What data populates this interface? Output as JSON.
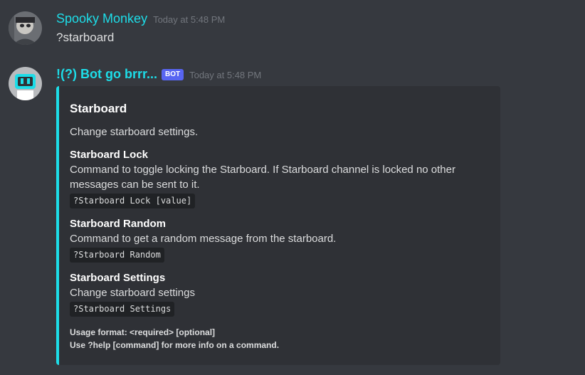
{
  "messages": [
    {
      "username": "Spooky Monkey",
      "timestamp": "Today at 5:48 PM",
      "content": "?starboard",
      "name_color": "#1ddde8"
    },
    {
      "username": "!(?) Bot go brrr...",
      "badge": "BOT",
      "timestamp": "Today at 5:48 PM",
      "name_color": "#1ddde8",
      "embed": {
        "accent_color": "#1ddde8",
        "title": "Starboard",
        "description": "Change starboard settings.",
        "fields": [
          {
            "name": "Starboard Lock",
            "line1": "Command to toggle locking the Starboard. If Starboard channel is locked no other",
            "line2": "messages can be sent to it.",
            "usage": "?Starboard Lock [value]"
          },
          {
            "name": "Starboard Random",
            "line1": "Command to get a random message from the starboard.",
            "usage": "?Starboard Random"
          },
          {
            "name": "Starboard Settings",
            "line1": "Change starboard settings",
            "usage": "?Starboard Settings"
          }
        ],
        "footer_line1": "Usage format: <required> [optional]",
        "footer_line2": "Use ?help [command] for more info on a command."
      }
    }
  ],
  "colors": {
    "background": "#36393f",
    "embed_background": "#2f3136",
    "bot_badge": "#5865f2",
    "timestamp": "#72767d"
  }
}
